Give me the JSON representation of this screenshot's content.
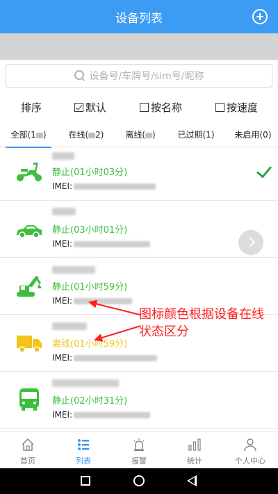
{
  "header": {
    "title": "设备列表",
    "add_icon": "plus-circle-icon"
  },
  "search": {
    "placeholder": "设备号/车牌号/sim号/昵称"
  },
  "sort": {
    "label": "排序",
    "options": [
      {
        "label": "默认",
        "checked": true
      },
      {
        "label": "按名称",
        "checked": false
      },
      {
        "label": "按速度",
        "checked": false
      }
    ]
  },
  "tabs": [
    {
      "prefix": "全部(1",
      "suffix": ")",
      "active": true
    },
    {
      "prefix": "在线(",
      "suffix": "2)",
      "active": false
    },
    {
      "prefix": "离线(",
      "suffix": ")",
      "active": false
    },
    {
      "label": "已过期(1)",
      "active": false
    },
    {
      "label": "未启用(0)",
      "active": false
    }
  ],
  "devices": [
    {
      "icon": "scooter-icon",
      "color": "#3dbe3d",
      "status": "静止(01小时03分)",
      "imei_label": "IMEI:",
      "selected": true
    },
    {
      "icon": "car-icon",
      "color": "#3dbe3d",
      "status": "静止(03小时01分)",
      "imei_label": "IMEI:",
      "has_next": true
    },
    {
      "icon": "excavator-icon",
      "color": "#3dbe3d",
      "status": "静止(01小时59分)",
      "imei_label": "IMEI:"
    },
    {
      "icon": "truck-icon",
      "color": "#f2c318",
      "status": "离线(01小时59分)",
      "imei_label": "IMEI:"
    },
    {
      "icon": "bus-icon",
      "color": "#3dbe3d",
      "status": "静止(02小时31分)",
      "imei_label": "IMEI:"
    }
  ],
  "annotation": {
    "text": "图标颜色根据设备在线状态区分",
    "color": "#ff2020"
  },
  "nav": [
    {
      "label": "首页",
      "icon": "home-icon",
      "active": false
    },
    {
      "label": "列表",
      "icon": "list-icon",
      "active": true
    },
    {
      "label": "报警",
      "icon": "alarm-icon",
      "active": false
    },
    {
      "label": "统计",
      "icon": "bar-chart-icon",
      "active": false
    },
    {
      "label": "个人中心",
      "icon": "person-icon",
      "active": false
    }
  ],
  "colors": {
    "primary": "#3c9bf2",
    "static": "#3dbe3d",
    "offline": "#f2c318",
    "check": "#27a844"
  }
}
